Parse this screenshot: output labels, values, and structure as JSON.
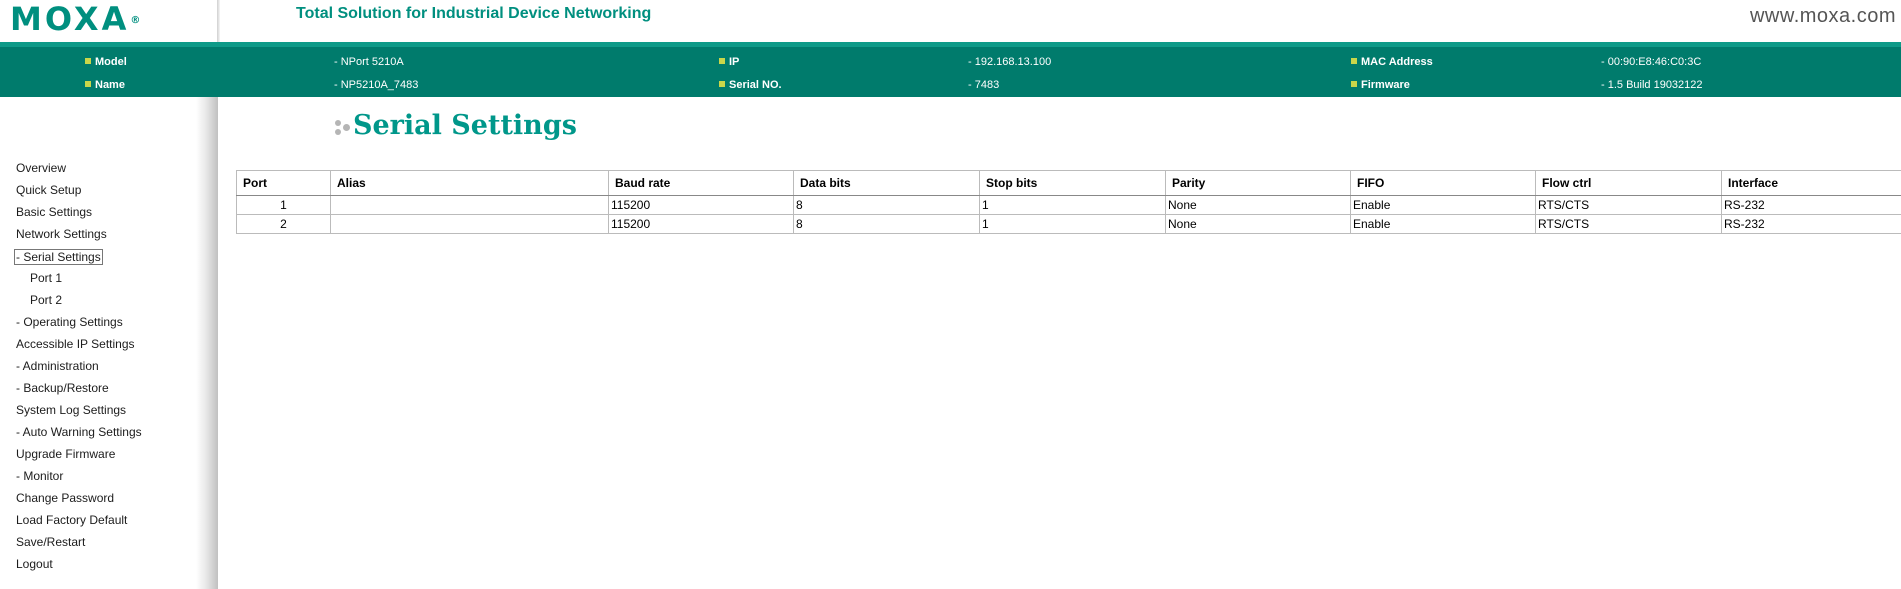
{
  "header": {
    "logo_text": "MOXA",
    "logo_mark": "®",
    "tagline": "Total Solution for Industrial Device Networking",
    "website": "www.moxa.com"
  },
  "device_info": {
    "model_label": "Model",
    "model_value": "- NPort 5210A",
    "name_label": "Name",
    "name_value": "- NP5210A_7483",
    "ip_label": "IP",
    "ip_value": "- 192.168.13.100",
    "serial_label": "Serial NO.",
    "serial_value": "- 7483",
    "mac_label": "MAC Address",
    "mac_value": "- 00:90:E8:46:C0:3C",
    "firmware_label": "Firmware",
    "firmware_value": "- 1.5 Build 19032122"
  },
  "sidebar": {
    "items": [
      {
        "label": "Overview"
      },
      {
        "label": "Quick Setup"
      },
      {
        "label": "Basic Settings"
      },
      {
        "label": "Network Settings"
      },
      {
        "label": "- Serial Settings"
      },
      {
        "label": "Port 1"
      },
      {
        "label": "Port 2"
      },
      {
        "label": "- Operating Settings"
      },
      {
        "label": "Accessible IP Settings"
      },
      {
        "label": "- Administration"
      },
      {
        "label": "- Backup/Restore"
      },
      {
        "label": "System Log Settings"
      },
      {
        "label": "- Auto Warning Settings"
      },
      {
        "label": "Upgrade Firmware"
      },
      {
        "label": "- Monitor"
      },
      {
        "label": "Change Password"
      },
      {
        "label": "Load Factory Default"
      },
      {
        "label": "Save/Restart"
      },
      {
        "label": "Logout"
      }
    ]
  },
  "main": {
    "title": "Serial Settings",
    "table": {
      "headers": [
        "Port",
        "Alias",
        "Baud rate",
        "Data bits",
        "Stop bits",
        "Parity",
        "FIFO",
        "Flow ctrl",
        "Interface"
      ],
      "rows": [
        [
          "1",
          "",
          "115200",
          "8",
          "1",
          "None",
          "Enable",
          "RTS/CTS",
          "RS-232"
        ],
        [
          "2",
          "",
          "115200",
          "8",
          "1",
          "None",
          "Enable",
          "RTS/CTS",
          "RS-232"
        ]
      ]
    }
  }
}
